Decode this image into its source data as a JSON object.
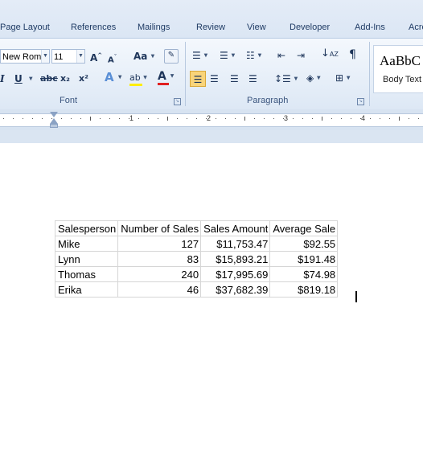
{
  "ribbon_tabs": [
    "Page Layout",
    "References",
    "Mailings",
    "Review",
    "View",
    "Developer",
    "Add-Ins",
    "Acro"
  ],
  "font": {
    "name": "New Rom",
    "size": "11",
    "group_label": "Font",
    "grow_icon": "A",
    "shrink_icon": "A",
    "change_case_icon": "Aa",
    "underline_icon": "U",
    "strikethrough_icon": "abc",
    "subscript_icon": "x₂",
    "superscript_icon": "x²",
    "text_effects_icon": "A",
    "highlight_icon": "ab",
    "font_color_icon": "A",
    "italic_icon": "I"
  },
  "paragraph": {
    "group_label": "Paragraph",
    "pilcrow_icon": "¶"
  },
  "styles": {
    "preview_text": "AaBbC",
    "style_name": "Body Text"
  },
  "ruler_numbers": [
    "1",
    "2",
    "3",
    "4"
  ],
  "table": {
    "headers": [
      "Salesperson",
      "Number of Sales",
      "Sales Amount",
      "Average Sale"
    ],
    "rows": [
      [
        "Mike",
        "127",
        "$11,753.47",
        "$92.55"
      ],
      [
        "Lynn",
        "83",
        "$15,893.21",
        "$191.48"
      ],
      [
        "Thomas",
        "240",
        "$17,995.69",
        "$74.98"
      ],
      [
        "Erika",
        "46",
        "$37,682.39",
        "$819.18"
      ]
    ]
  },
  "colors": {
    "font_color_bar": "#e02020",
    "highlight_bar": "#ffee00",
    "active_align": "#f9d47a"
  }
}
